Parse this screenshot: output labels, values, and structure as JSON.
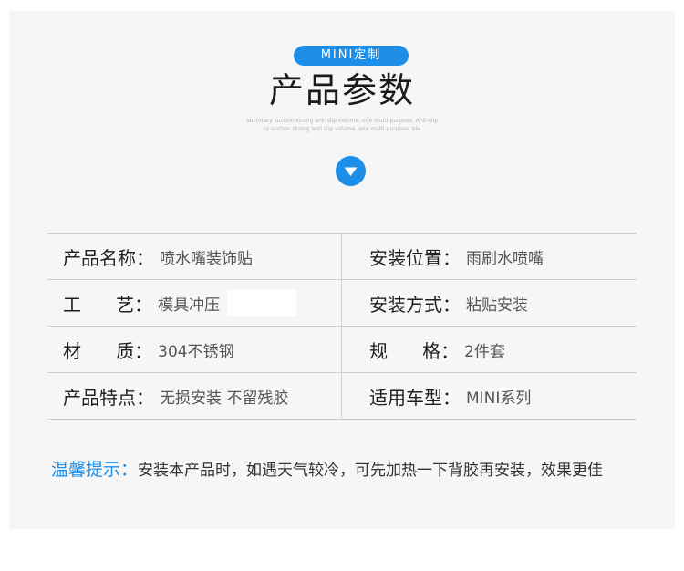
{
  "badge": "MINI定制",
  "title": "产品参数",
  "subtitle_line1": "abcrotary suction strong anti slip volume, one multi-purpose, Anti-slip",
  "subtitle_line2": "ry suction strong anti slip volume, one multi-purpose, ble",
  "arrow_icon": "chevron-down-circle-icon",
  "accent_color": "#1d8fe8",
  "params": [
    {
      "left_label": "产品名称：",
      "left_value": "喷水嘴装饰贴",
      "right_label": "安装位置：",
      "right_value": "雨刷水喷嘴"
    },
    {
      "left_label": "工      艺：",
      "left_value": "模具冲压",
      "right_label": "安装方式：",
      "right_value": "粘贴安装"
    },
    {
      "left_label": "材      质：",
      "left_value": "304不锈钢",
      "right_label": "规      格：",
      "right_value": "2件套"
    },
    {
      "left_label": "产品特点：",
      "left_value": "无损安装 不留残胶",
      "right_label": "适用车型：",
      "right_value": "MINI系列"
    }
  ],
  "tip": {
    "label": "温馨提示：",
    "text": "安装本产品时，如遇天气较冷，可先加热一下背胶再安装，效果更佳"
  }
}
